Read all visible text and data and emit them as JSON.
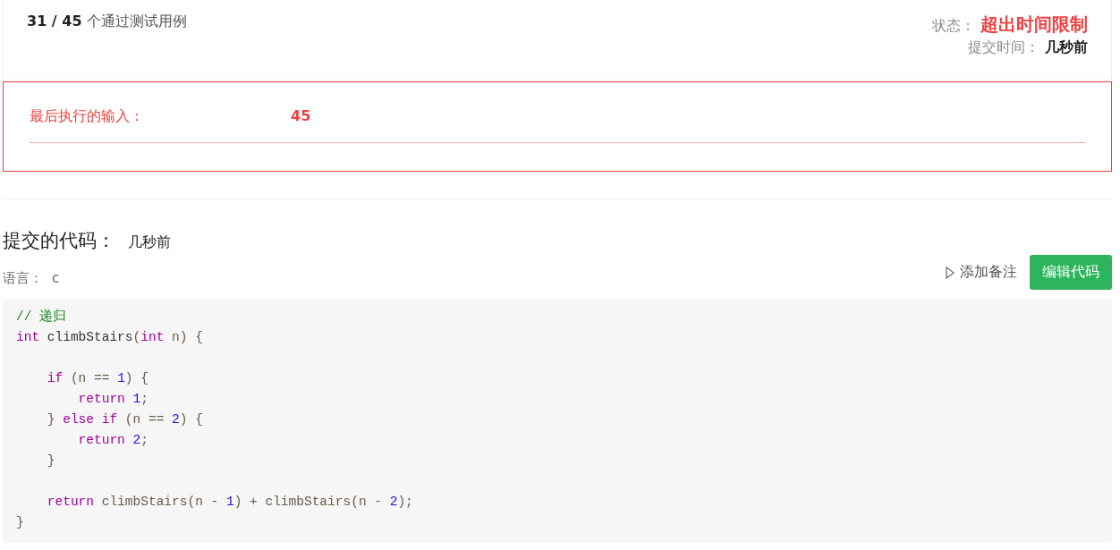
{
  "result": {
    "passed": "31 / 45",
    "passed_label": "个通过测试用例",
    "status_label": "状态：",
    "status": "超出时间限制",
    "time_label": "提交时间：",
    "time": "几秒前"
  },
  "last_input": {
    "label": "最后执行的输入：",
    "value": "45"
  },
  "submission": {
    "title": "提交的代码：",
    "time": "几秒前",
    "language_label": "语言：",
    "language": "c",
    "add_note": "添加备注",
    "edit_button": "编辑代码",
    "code_lines": [
      {
        "kind": "code",
        "tokens": [
          {
            "kind": "comment",
            "text": "// 递归"
          }
        ]
      },
      {
        "kind": "code",
        "tokens": [
          {
            "kind": "keyword",
            "text": "int"
          },
          {
            "kind": "name",
            "text": " climbStairs"
          },
          {
            "kind": "plain",
            "text": "("
          },
          {
            "kind": "keyword",
            "text": "int"
          },
          {
            "kind": "plain",
            "text": " n) {"
          }
        ]
      },
      {
        "kind": "blank"
      },
      {
        "kind": "code",
        "tokens": [
          {
            "kind": "keyword",
            "text": "    if"
          },
          {
            "kind": "plain",
            "text": " (n == "
          },
          {
            "kind": "number",
            "text": "1"
          },
          {
            "kind": "plain",
            "text": ") {"
          }
        ]
      },
      {
        "kind": "code",
        "tokens": [
          {
            "kind": "keyword",
            "text": "        return"
          },
          {
            "kind": "number",
            "text": " 1"
          },
          {
            "kind": "plain",
            "text": ";"
          }
        ]
      },
      {
        "kind": "code",
        "tokens": [
          {
            "kind": "plain",
            "text": "    } "
          },
          {
            "kind": "keyword",
            "text": "else if"
          },
          {
            "kind": "plain",
            "text": " (n == "
          },
          {
            "kind": "number",
            "text": "2"
          },
          {
            "kind": "plain",
            "text": ") {"
          }
        ]
      },
      {
        "kind": "code",
        "tokens": [
          {
            "kind": "keyword",
            "text": "        return"
          },
          {
            "kind": "number",
            "text": " 2"
          },
          {
            "kind": "plain",
            "text": ";"
          }
        ]
      },
      {
        "kind": "code",
        "tokens": [
          {
            "kind": "plain",
            "text": "    }"
          }
        ]
      },
      {
        "kind": "blank"
      },
      {
        "kind": "code",
        "tokens": [
          {
            "kind": "keyword",
            "text": "    return"
          },
          {
            "kind": "plain",
            "text": " climbStairs(n - "
          },
          {
            "kind": "number",
            "text": "1"
          },
          {
            "kind": "plain",
            "text": ") + climbStairs(n - "
          },
          {
            "kind": "number",
            "text": "2"
          },
          {
            "kind": "plain",
            "text": ");"
          }
        ]
      },
      {
        "kind": "code",
        "tokens": [
          {
            "kind": "plain",
            "text": "}"
          }
        ]
      }
    ]
  }
}
